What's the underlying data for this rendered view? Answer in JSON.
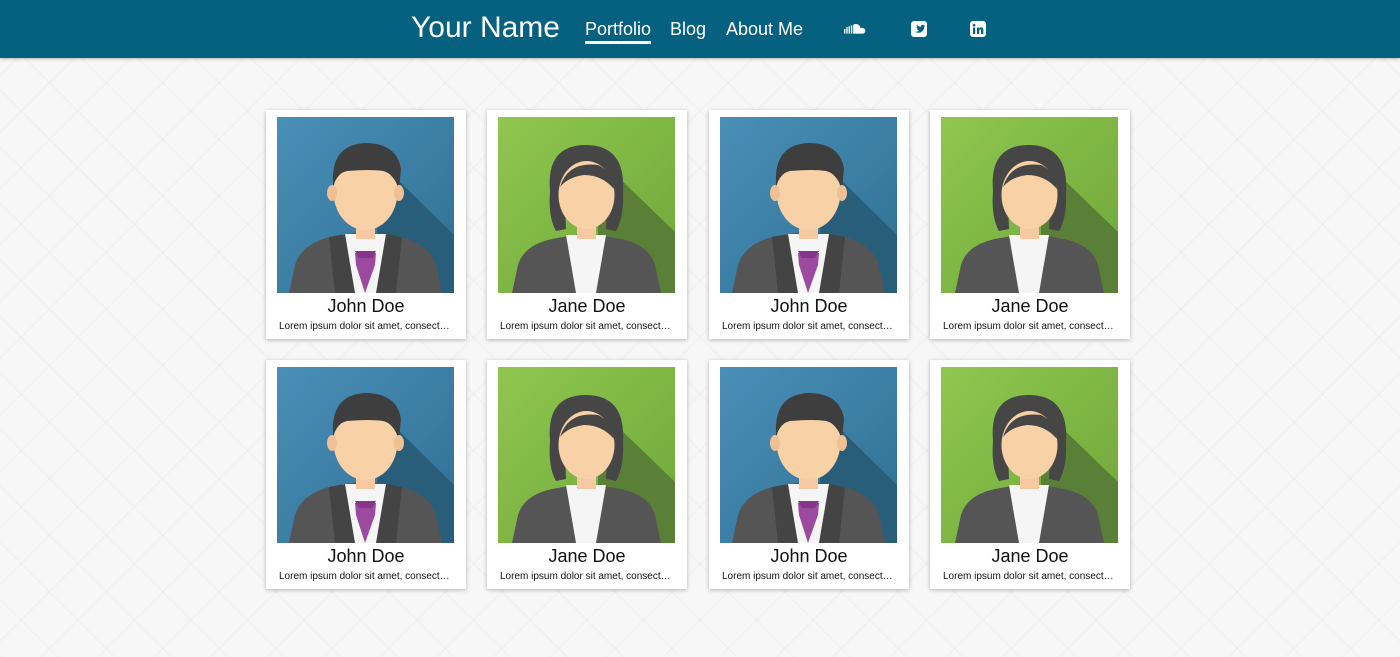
{
  "header": {
    "brand": "Your Name",
    "nav": [
      {
        "label": "Portfolio",
        "active": true
      },
      {
        "label": "Blog",
        "active": false
      },
      {
        "label": "About Me",
        "active": false
      }
    ],
    "social": [
      {
        "icon": "soundcloud-icon"
      },
      {
        "icon": "twitter-icon"
      },
      {
        "icon": "linkedin-icon"
      }
    ]
  },
  "colors": {
    "header_bg": "#066080",
    "male_bg": "#3e87ad",
    "female_bg": "#8bc34a",
    "tie": "#9b4aa0",
    "suit": "#555555"
  },
  "portfolio": {
    "items": [
      {
        "name": "John Doe",
        "description": "Lorem ipsum dolor sit amet, consectetur adipiscing elit",
        "avatar": "male"
      },
      {
        "name": "Jane Doe",
        "description": "Lorem ipsum dolor sit amet, consectetur adipiscing elit",
        "avatar": "female"
      },
      {
        "name": "John Doe",
        "description": "Lorem ipsum dolor sit amet, consectetur adipiscing elit",
        "avatar": "male"
      },
      {
        "name": "Jane Doe",
        "description": "Lorem ipsum dolor sit amet, consectetur adipiscing elit",
        "avatar": "female"
      },
      {
        "name": "John Doe",
        "description": "Lorem ipsum dolor sit amet, consectetur adipiscing elit",
        "avatar": "male"
      },
      {
        "name": "Jane Doe",
        "description": "Lorem ipsum dolor sit amet, consectetur adipiscing elit",
        "avatar": "female"
      },
      {
        "name": "John Doe",
        "description": "Lorem ipsum dolor sit amet, consectetur adipiscing elit",
        "avatar": "male"
      },
      {
        "name": "Jane Doe",
        "description": "Lorem ipsum dolor sit amet, consectetur adipiscing elit",
        "avatar": "female"
      }
    ]
  }
}
